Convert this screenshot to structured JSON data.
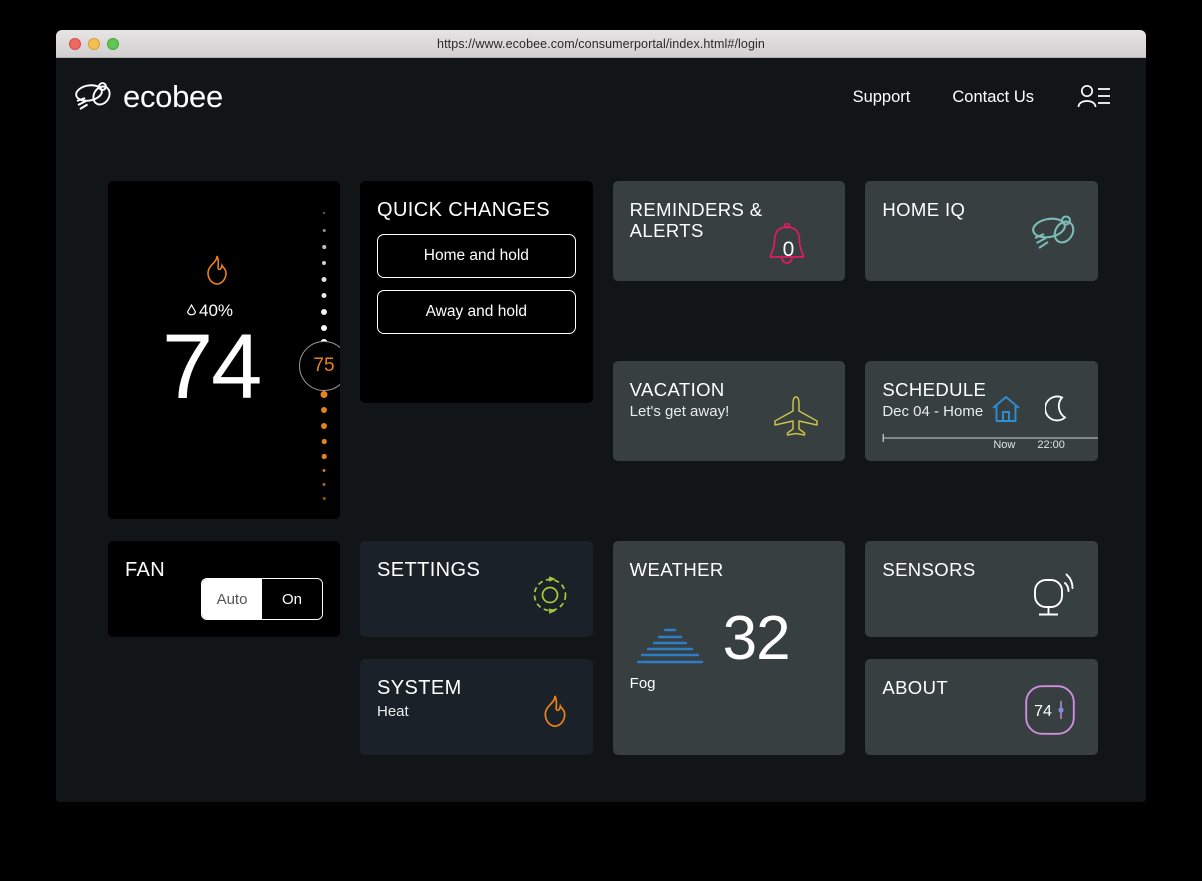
{
  "browser": {
    "url": "https://www.ecobee.com/consumerportal/index.html#/login"
  },
  "header": {
    "brand": "ecobee",
    "nav": [
      {
        "label": "Support"
      },
      {
        "label": "Contact Us"
      }
    ],
    "account_icon": "user-account-icon"
  },
  "thermostat": {
    "mode_icon": "flame-icon",
    "humidity": "40%",
    "humidity_icon": "droplet-icon",
    "current_temp": "74",
    "setpoint": "75"
  },
  "fan": {
    "title": "FAN",
    "options": [
      {
        "label": "Auto",
        "selected": true
      },
      {
        "label": "On",
        "selected": false
      }
    ]
  },
  "quick_changes": {
    "title": "QUICK CHANGES",
    "buttons": [
      {
        "label": "Home and hold"
      },
      {
        "label": "Away and hold"
      }
    ]
  },
  "settings": {
    "title": "SETTINGS",
    "icon": "gear-icon",
    "icon_color": "#a6ce39"
  },
  "system": {
    "title": "SYSTEM",
    "sub": "Heat",
    "icon": "flame-icon",
    "icon_color": "#e8821e"
  },
  "reminders": {
    "title_line1": "REMINDERS &",
    "title_line2": "ALERTS",
    "count": "0",
    "icon": "bell-icon",
    "icon_color": "#e31b5d"
  },
  "vacation": {
    "title": "VACATION",
    "sub": "Let's get away!",
    "icon": "airplane-icon",
    "icon_color": "#c8c246"
  },
  "weather": {
    "title": "WEATHER",
    "temp": "32",
    "condition": "Fog",
    "icon": "fog-icon",
    "icon_color": "#2d7ec4"
  },
  "home_iq": {
    "title": "HOME IQ",
    "icon": "bee-icon",
    "icon_color": "#7bbcb8"
  },
  "schedule": {
    "title": "SCHEDULE",
    "sub": "Dec 04 - Home",
    "home_icon": "home-icon",
    "home_icon_color": "#2d8fd5",
    "moon_icon": "moon-icon",
    "now_label": "Now",
    "time_label": "22:00"
  },
  "sensors": {
    "title": "SENSORS",
    "icon": "sensor-icon",
    "icon_color": "#ffffff"
  },
  "about": {
    "title": "ABOUT",
    "device_temp": "74",
    "icon": "thermostat-device-icon",
    "icon_color": "#cf8fe0"
  }
}
